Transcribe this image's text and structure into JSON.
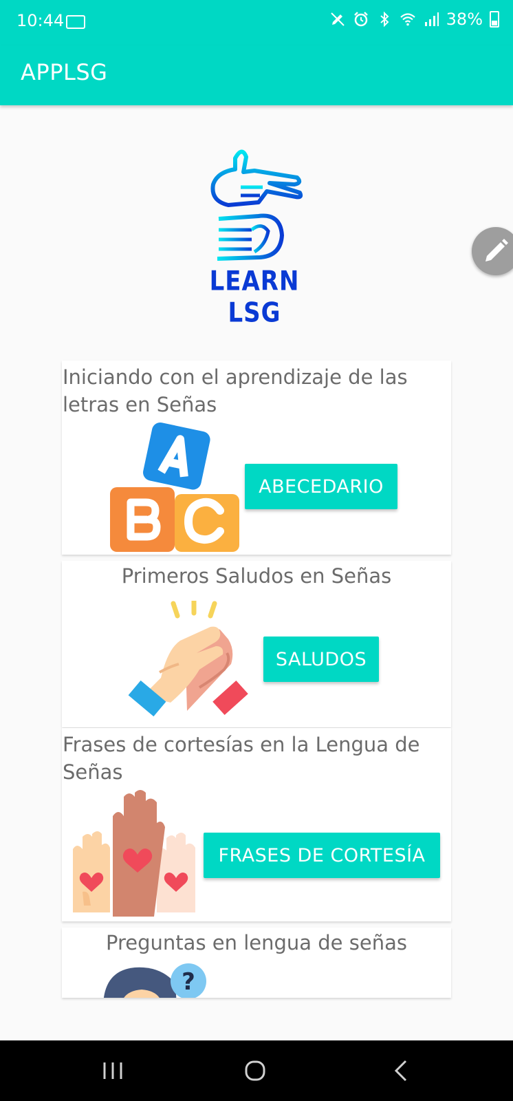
{
  "status": {
    "time": "10:44",
    "battery": "38%"
  },
  "app": {
    "title": "APPLSG"
  },
  "logo": {
    "text": "LEARN LSG"
  },
  "cards": [
    {
      "description": "Iniciando con el aprendizaje de las letras en Señas",
      "button": "ABECEDARIO",
      "icon": "abc-blocks-icon"
    },
    {
      "description": "Primeros Saludos en Señas",
      "button": "SALUDOS",
      "icon": "high-five-icon"
    },
    {
      "description": "Frases de cortesías en la Lengua de Señas",
      "button": "FRASES DE CORTESÍA",
      "icon": "raised-hands-hearts-icon"
    },
    {
      "description": "Preguntas en lengua de señas",
      "icon": "person-question-icon"
    }
  ],
  "colors": {
    "primary": "#00d8c4",
    "text": "#6b6b6b",
    "fab": "#9e9e9e"
  }
}
